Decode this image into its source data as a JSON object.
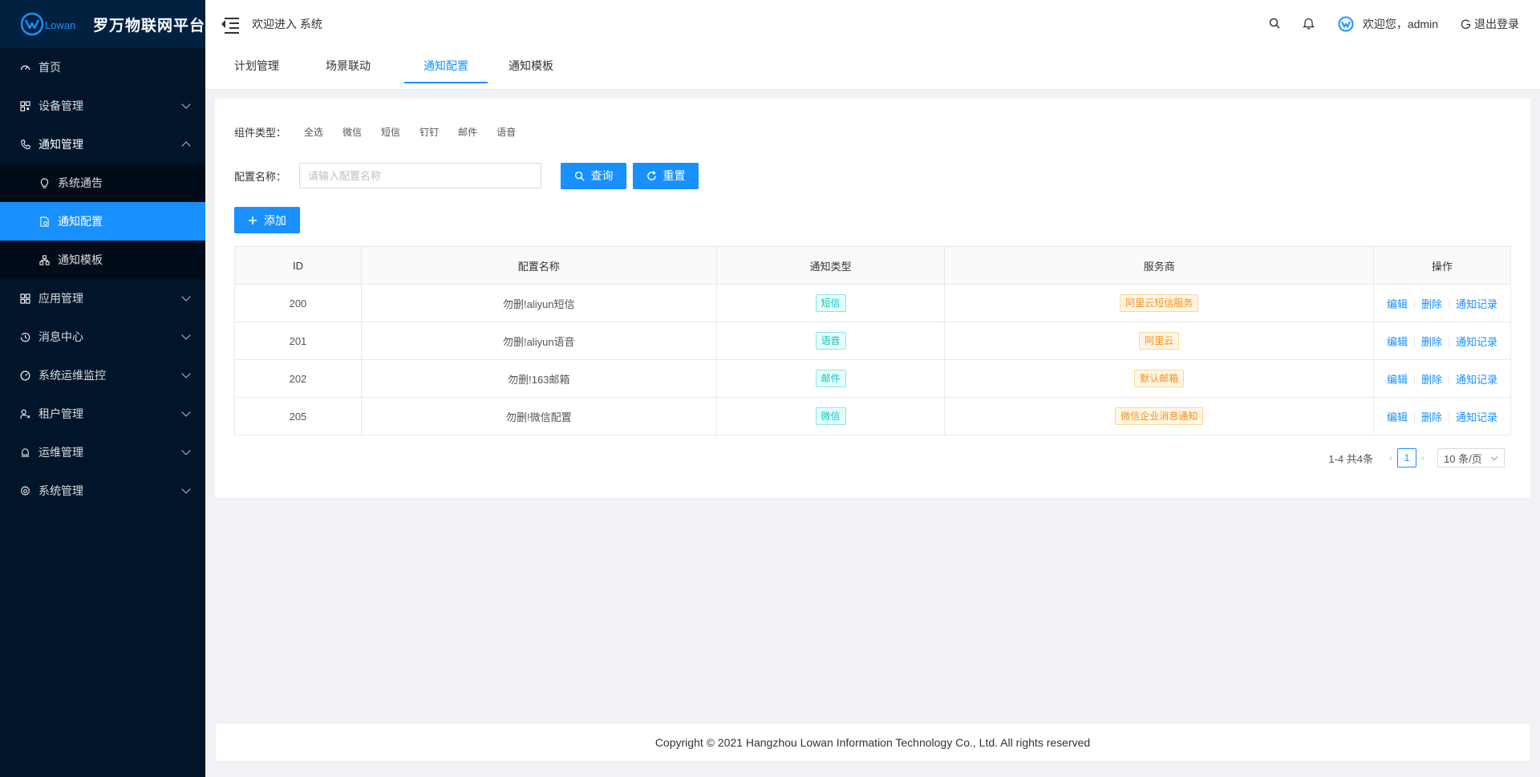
{
  "brand": {
    "logo_text": "Lowan",
    "title": "罗万物联网平台"
  },
  "sidebar": {
    "items": [
      {
        "label": "首页"
      },
      {
        "label": "设备管理"
      },
      {
        "label": "通知管理"
      },
      {
        "label": "应用管理"
      },
      {
        "label": "消息中心"
      },
      {
        "label": "系统运维监控"
      },
      {
        "label": "租户管理"
      },
      {
        "label": "运维管理"
      },
      {
        "label": "系统管理"
      }
    ],
    "notify_sub": [
      {
        "label": "系统通告"
      },
      {
        "label": "通知配置"
      },
      {
        "label": "通知模板"
      }
    ]
  },
  "header": {
    "welcome": "欢迎进入 系统",
    "user_greeting": "欢迎您，admin",
    "logout": "退出登录"
  },
  "tabs": [
    {
      "label": "计划管理"
    },
    {
      "label": "场景联动"
    },
    {
      "label": "通知配置"
    },
    {
      "label": "通知模板"
    }
  ],
  "filter": {
    "label": "组件类型：",
    "options": [
      "全选",
      "微信",
      "短信",
      "钉钉",
      "邮件",
      "语音"
    ]
  },
  "search": {
    "label": "配置名称：",
    "placeholder": "请输入配置名称",
    "query_label": "查询",
    "reset_label": "重置",
    "add_label": "添加"
  },
  "table": {
    "headers": [
      "ID",
      "配置名称",
      "通知类型",
      "服务商",
      "操作"
    ],
    "rows": [
      {
        "id": "200",
        "name": "勿删!aliyun短信",
        "type": "短信",
        "provider": "阿里云短信服务"
      },
      {
        "id": "201",
        "name": "勿删!aliyun语音",
        "type": "语音",
        "provider": "阿里云"
      },
      {
        "id": "202",
        "name": "勿删!163邮箱",
        "type": "邮件",
        "provider": "默认邮箱"
      },
      {
        "id": "205",
        "name": "勿删!微信配置",
        "type": "微信",
        "provider": "微信企业消息通知"
      }
    ],
    "ops": {
      "edit": "编辑",
      "delete": "删除",
      "records": "通知记录"
    }
  },
  "pagination": {
    "summary": "1-4 共4条",
    "current_page": "1",
    "page_size": "10 条/页"
  },
  "footer": {
    "copyright": "Copyright © 2021 Hangzhou Lowan Information Technology Co., Ltd. All rights reserved"
  },
  "colors": {
    "primary": "#1890ff",
    "sidebar_bg": "#001529",
    "tag_cyan": "#13c2c2",
    "tag_orange": "#fa8c16"
  }
}
